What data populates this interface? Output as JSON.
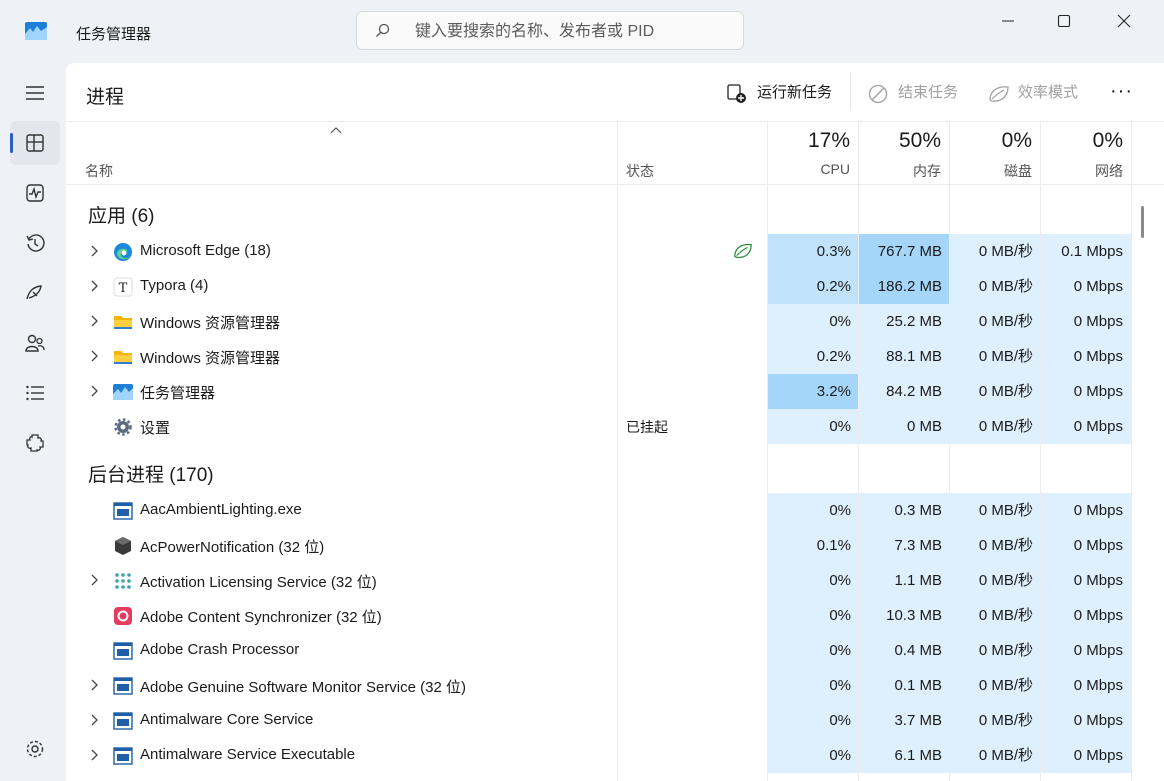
{
  "window": {
    "title": "任务管理器",
    "search_placeholder": "键入要搜索的名称、发布者或 PID"
  },
  "page": {
    "title": "进程",
    "commands": {
      "run_new_task": "运行新任务",
      "end_task": "结束任务",
      "efficiency_mode": "效率模式",
      "more": "···"
    }
  },
  "columns": {
    "name": "名称",
    "status": "状态",
    "cpu": {
      "pct": "17%",
      "label": "CPU"
    },
    "memory": {
      "pct": "50%",
      "label": "内存"
    },
    "disk": {
      "pct": "0%",
      "label": "磁盘"
    },
    "network": {
      "pct": "0%",
      "label": "网络"
    }
  },
  "groups": {
    "apps": {
      "title": "应用 (6)",
      "rows": [
        {
          "name": "Microsoft Edge (18)",
          "icon": "edge-icon",
          "expandable": true,
          "status": "",
          "efficiency": true,
          "cpu": "0.3%",
          "mem": "767.7 MB",
          "disk": "0 MB/秒",
          "net": "0.1 Mbps"
        },
        {
          "name": "Typora (4)",
          "icon": "typora-icon",
          "expandable": true,
          "status": "",
          "cpu": "0.2%",
          "mem": "186.2 MB",
          "disk": "0 MB/秒",
          "net": "0 Mbps"
        },
        {
          "name": "Windows 资源管理器",
          "icon": "folder-icon",
          "expandable": true,
          "status": "",
          "cpu": "0%",
          "mem": "25.2 MB",
          "disk": "0 MB/秒",
          "net": "0 Mbps"
        },
        {
          "name": "Windows 资源管理器",
          "icon": "folder-icon",
          "expandable": true,
          "status": "",
          "cpu": "0.2%",
          "mem": "88.1 MB",
          "disk": "0 MB/秒",
          "net": "0 Mbps"
        },
        {
          "name": "任务管理器",
          "icon": "task-manager-icon",
          "expandable": true,
          "status": "",
          "cpu": "3.2%",
          "mem": "84.2 MB",
          "disk": "0 MB/秒",
          "net": "0 Mbps"
        },
        {
          "name": "设置",
          "icon": "settings-gear-icon",
          "expandable": false,
          "status": "已挂起",
          "cpu": "0%",
          "mem": "0 MB",
          "disk": "0 MB/秒",
          "net": "0 Mbps"
        }
      ]
    },
    "background": {
      "title": "后台进程 (170)",
      "rows": [
        {
          "name": "AacAmbientLighting.exe",
          "icon": "app-window-icon",
          "expandable": false,
          "cpu": "0%",
          "mem": "0.3 MB",
          "disk": "0 MB/秒",
          "net": "0 Mbps"
        },
        {
          "name": "AcPowerNotification (32 位)",
          "icon": "cube-icon",
          "expandable": false,
          "cpu": "0.1%",
          "mem": "7.3 MB",
          "disk": "0 MB/秒",
          "net": "0 Mbps"
        },
        {
          "name": "Activation Licensing Service (32 位)",
          "icon": "dots-icon",
          "expandable": true,
          "cpu": "0%",
          "mem": "1.1 MB",
          "disk": "0 MB/秒",
          "net": "0 Mbps"
        },
        {
          "name": "Adobe Content Synchronizer (32 位)",
          "icon": "adobe-cc-icon",
          "expandable": false,
          "cpu": "0%",
          "mem": "10.3 MB",
          "disk": "0 MB/秒",
          "net": "0 Mbps"
        },
        {
          "name": "Adobe Crash Processor",
          "icon": "app-window-icon",
          "expandable": false,
          "cpu": "0%",
          "mem": "0.4 MB",
          "disk": "0 MB/秒",
          "net": "0 Mbps"
        },
        {
          "name": "Adobe Genuine Software Monitor Service (32 位)",
          "icon": "app-window-icon",
          "expandable": true,
          "cpu": "0%",
          "mem": "0.1 MB",
          "disk": "0 MB/秒",
          "net": "0 Mbps"
        },
        {
          "name": "Antimalware Core Service",
          "icon": "app-window-icon",
          "expandable": true,
          "cpu": "0%",
          "mem": "3.7 MB",
          "disk": "0 MB/秒",
          "net": "0 Mbps"
        },
        {
          "name": "Antimalware Service Executable",
          "icon": "app-window-icon",
          "expandable": true,
          "cpu": "0%",
          "mem": "6.1 MB",
          "disk": "0 MB/秒",
          "net": "0 Mbps"
        }
      ]
    }
  },
  "nav_icons": [
    "hamburger-menu-icon",
    "processes-icon",
    "performance-icon",
    "app-history-icon",
    "startup-apps-icon",
    "users-icon",
    "details-icon",
    "services-icon",
    "settings-icon"
  ],
  "colors": {
    "heat_low": "#def0fd",
    "heat_mid": "#c0e3fb",
    "heat_high": "#a5d6fa",
    "accent": "#2d5fbf"
  }
}
